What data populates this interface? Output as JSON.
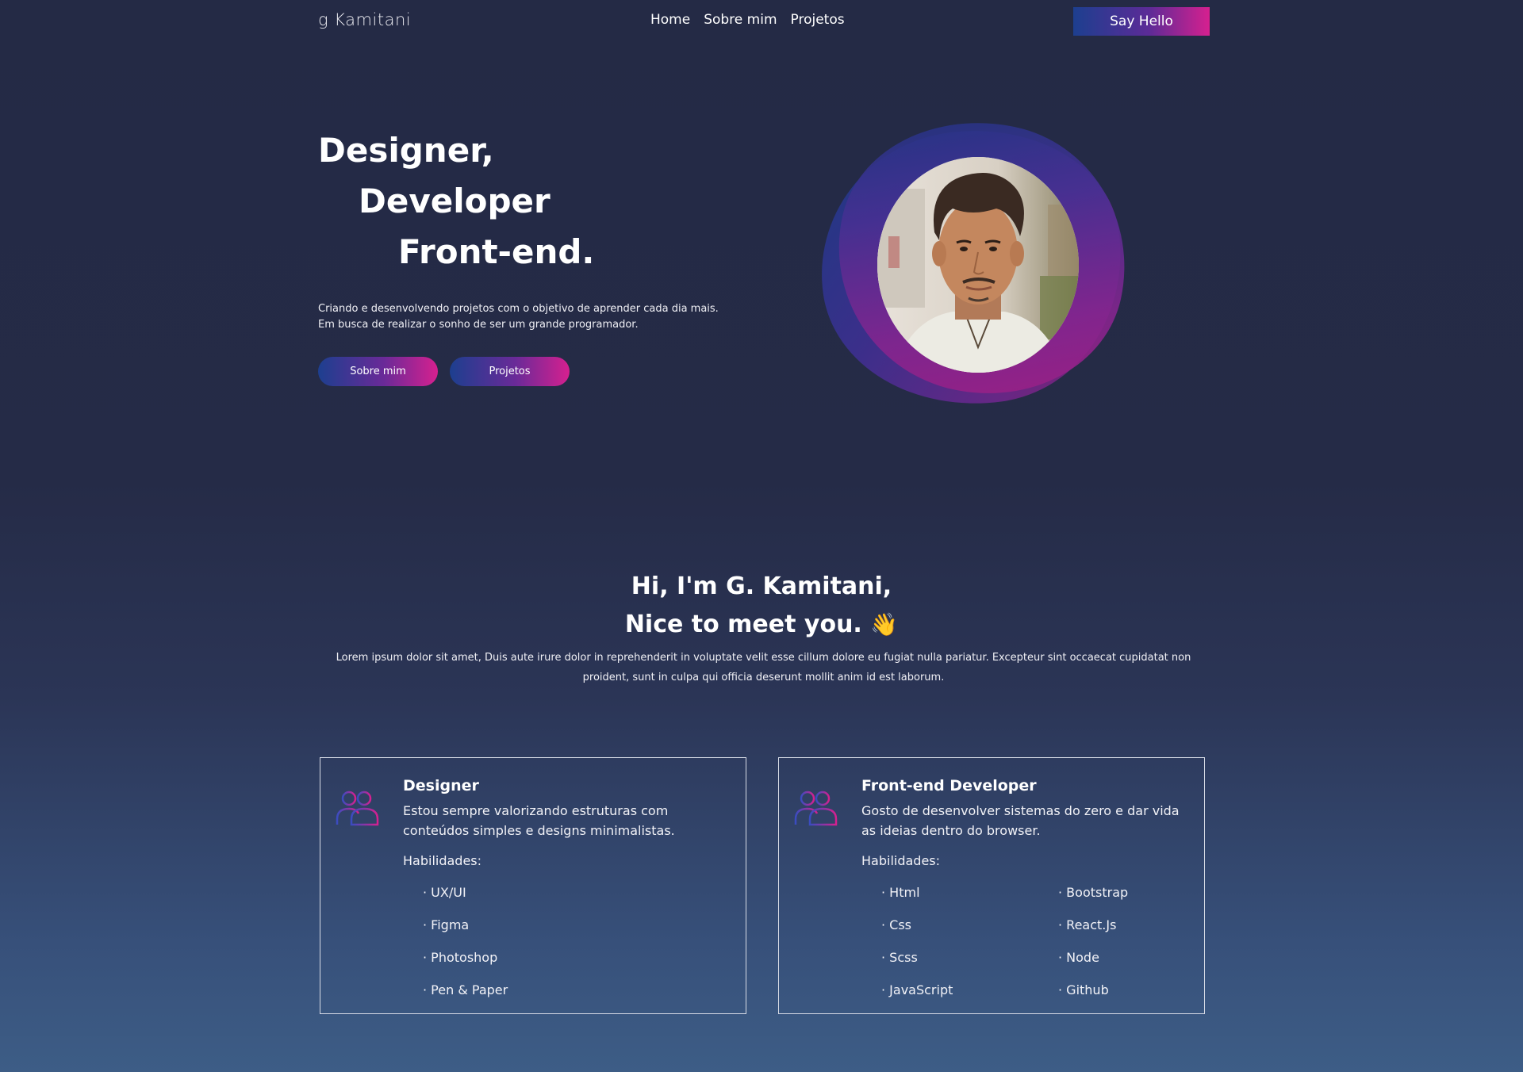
{
  "nav": {
    "logo": "g  Kamitani",
    "links": [
      "Home",
      "Sobre mim",
      "Projetos"
    ],
    "cta": "Say Hello"
  },
  "hero": {
    "title_lines": [
      "Designer,",
      "Developer",
      "Front-end."
    ],
    "description": "Criando e desenvolvendo projetos com o objetivo de aprender cada dia mais. Em busca de realizar o sonho de ser um grande programador.",
    "buttons": [
      "Sobre mim",
      "Projetos"
    ]
  },
  "about": {
    "line1": "Hi, I'm G. Kamitani,",
    "line2": "Nice to meet you.",
    "emoji": "👋",
    "description": "Lorem ipsum dolor sit amet, Duis aute irure dolor in reprehenderit in voluptate velit esse cillum dolore eu fugiat nulla pariatur. Excepteur sint occaecat cupidatat non proident, sunt in culpa qui officia deserunt mollit anim id est laborum."
  },
  "cards": [
    {
      "icon": "users-icon",
      "title": "Designer",
      "text": "Estou sempre valorizando estruturas com conteúdos simples e designs minimalistas.",
      "skills_label": "Habilidades:",
      "skills_col1": [
        "· UX/UI",
        "· Figma",
        "· Photoshop",
        "· Pen & Paper"
      ],
      "skills_col2": []
    },
    {
      "icon": "users-icon",
      "title": "Front-end Developer",
      "text": "Gosto de desenvolver sistemas do zero e dar vida as ideias dentro do browser.",
      "skills_label": "Habilidades:",
      "skills_col1": [
        "· Html",
        "· Css",
        "· Scss",
        "· JavaScript"
      ],
      "skills_col2": [
        "· Bootstrap",
        "· React.Js",
        "· Node",
        "· Github"
      ]
    }
  ],
  "colors": {
    "background_top": "#242a45",
    "background_bottom": "#3d5d86",
    "gradient_start": "#1d3f8f",
    "gradient_end": "#d6208f"
  }
}
